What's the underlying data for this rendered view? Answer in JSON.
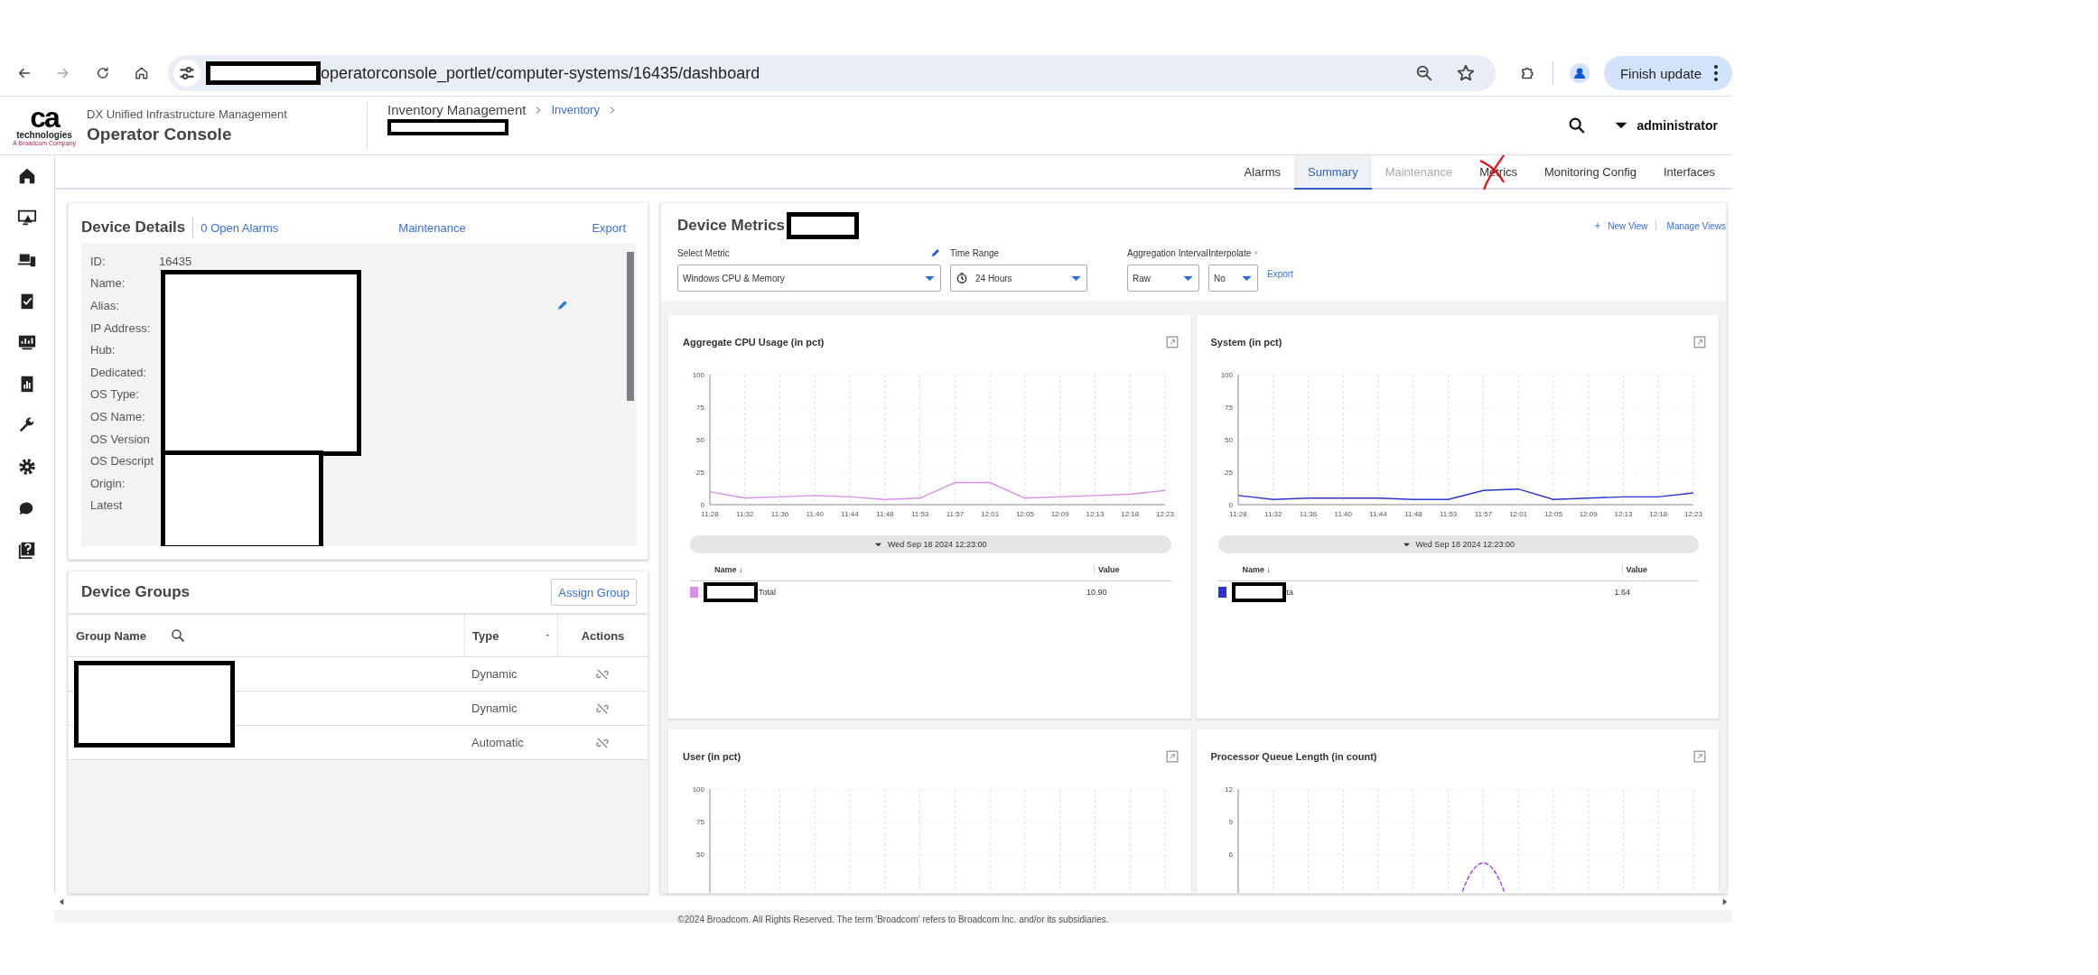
{
  "browser": {
    "url_redacted": true,
    "url": "operatorconsole_portlet/computer-systems/16435/dashboard",
    "update_button": "Finish update"
  },
  "app": {
    "logo_mark": "ca",
    "logo_word": "technologies",
    "logo_tagline": "A Broadcom Company",
    "product": "DX Unified Infrastructure Management",
    "title": "Operator Console",
    "user": "administrator"
  },
  "breadcrumb": [
    {
      "label": "Inventory Management",
      "link": false
    },
    {
      "label": "Inventory",
      "link": true
    }
  ],
  "breadcrumb_current_redacted": true,
  "tabs": [
    {
      "label": "Alarms",
      "selected": false,
      "disabled": false,
      "crossed_out": false
    },
    {
      "label": "Summary",
      "selected": true,
      "disabled": false,
      "crossed_out": false
    },
    {
      "label": "Maintenance",
      "selected": false,
      "disabled": true,
      "crossed_out": false
    },
    {
      "label": "Metrics",
      "selected": false,
      "disabled": false,
      "crossed_out": true
    },
    {
      "label": "Monitoring Config",
      "selected": false,
      "disabled": false,
      "crossed_out": false
    },
    {
      "label": "Interfaces",
      "selected": false,
      "disabled": false,
      "crossed_out": false
    }
  ],
  "device_details": {
    "title": "Device Details",
    "open_alarms": "0 Open Alarms",
    "maintenance": "Maintenance",
    "export": "Export",
    "values_redacted": true,
    "fields": [
      {
        "label": "ID:",
        "value": "16435"
      },
      {
        "label": "Name:"
      },
      {
        "label": "Alias:",
        "editable": true
      },
      {
        "label": "IP Address:"
      },
      {
        "label": "Hub:"
      },
      {
        "label": "Dedicated:"
      },
      {
        "label": "OS Type:"
      },
      {
        "label": "OS Name:"
      },
      {
        "label": "OS Version"
      },
      {
        "label": "OS Descript"
      },
      {
        "label": "Origin:"
      },
      {
        "label": "Latest"
      }
    ]
  },
  "device_groups": {
    "title": "Device Groups",
    "assign_button": "Assign Group",
    "names_redacted": true,
    "columns": [
      "Group Name",
      "Type",
      "Actions"
    ],
    "rows": [
      {
        "type": "Dynamic"
      },
      {
        "type": "Dynamic"
      },
      {
        "type": "Automatic"
      }
    ]
  },
  "device_metrics": {
    "title": "Device Metrics",
    "title_redacted": true,
    "new_view": "New View",
    "manage_views": "Manage Views",
    "controls": [
      {
        "label": "Select Metric",
        "value": "Windows CPU & Memory",
        "kind": "select",
        "editable": true
      },
      {
        "label": "Time Range",
        "value": "24 Hours",
        "kind": "time"
      },
      {
        "label": "Aggregation Interval",
        "value": "Raw",
        "kind": "select"
      },
      {
        "label": "Interpolate",
        "value": "No",
        "kind": "help"
      }
    ],
    "export": "Export",
    "charts": [
      {
        "title": "Aggregate CPU Usage (in pct)",
        "timestamp": "Wed Sep 18 2024 12:23:00",
        "legend_columns": [
          "Name ↓",
          "Value"
        ],
        "legend": [
          {
            "name_redacted": true,
            "value": "10.90"
          }
        ],
        "chart_data": {
          "type": "line",
          "grid": true,
          "categories": [
            "11:28",
            "11:32",
            "11:36",
            "11:40",
            "11:44",
            "11:48",
            "11:53",
            "11:57",
            "12:01",
            "12:05",
            "12:09",
            "12:13",
            "12:18",
            "12:23"
          ],
          "ylim": [
            0,
            100
          ],
          "yticks": [
            0,
            25,
            50,
            75,
            100
          ],
          "series": [
            {
              "name": "Total",
              "color": "#d98fe9",
              "values": [
                10,
                5,
                6,
                7,
                6,
                4,
                5,
                17,
                17,
                5,
                6,
                7,
                8,
                11
              ]
            }
          ]
        }
      },
      {
        "title": "System (in pct)",
        "timestamp": "Wed Sep 18 2024 12:23:00",
        "legend_columns": [
          "Name ↓",
          "Value"
        ],
        "legend": [
          {
            "name_redacted": true,
            "value": "1.64"
          }
        ],
        "chart_data": {
          "type": "line",
          "grid": true,
          "categories": [
            "11:28",
            "11:32",
            "11:36",
            "11:40",
            "11:44",
            "11:48",
            "11:53",
            "11:57",
            "12:01",
            "12:05",
            "12:09",
            "12:13",
            "12:18",
            "12:23"
          ],
          "ylim": [
            0,
            100
          ],
          "yticks": [
            0,
            25,
            50,
            75,
            100
          ],
          "series": [
            {
              "name": "ta",
              "color": "#2a35d0",
              "values": [
                7,
                4,
                5,
                5,
                5,
                4,
                4,
                11,
                12,
                4,
                5,
                6,
                6,
                9
              ]
            }
          ]
        }
      },
      {
        "title": "User (in pct)",
        "kind": "empty",
        "axis_labels": [
          "100",
          "75",
          "50"
        ]
      },
      {
        "title": "Processor Queue Length (in count)",
        "kind": "trace",
        "axis_labels": [
          "12",
          "9",
          "6"
        ]
      }
    ]
  },
  "footer": "©2024 Broadcom. All Rights Reserved. The term 'Broadcom' refers to Broadcom Inc. and/or its subsidiaries."
}
